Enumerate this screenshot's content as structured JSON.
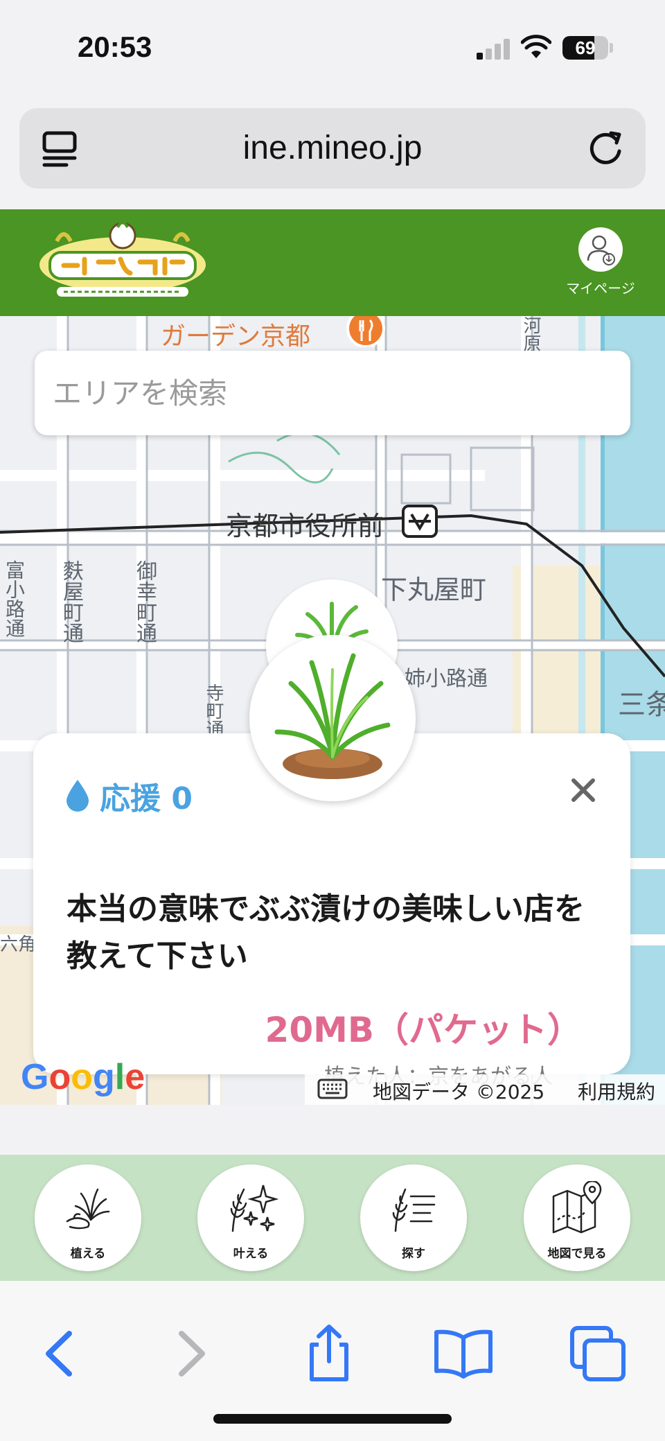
{
  "status_bar": {
    "time": "20:53",
    "battery": "69",
    "battery_level": 0.69
  },
  "browser": {
    "url": "ine.mineo.jp"
  },
  "header": {
    "logo_alt": "ネガイナホ",
    "mypage_label": "マイページ"
  },
  "map": {
    "search_placeholder": "エリアを検索",
    "labels": {
      "restaurant": "ガーデン京都",
      "station": "京都市役所前",
      "town1": "下丸屋町",
      "street_anekoji": "姉小路通",
      "town2": "三条",
      "street_fuyacho": "麩屋町通",
      "street_gokomachi": "御幸町通",
      "street_tominokoji": "富小路通",
      "street_teramachi": "寺町通",
      "rokkaku": "六角通",
      "street_kawaramachi": "河原町通"
    },
    "footer": {
      "map_data": "地図データ ©2025",
      "terms": "利用規約"
    },
    "google": [
      "G",
      "o",
      "o",
      "g",
      "l",
      "e"
    ]
  },
  "wish_card": {
    "cheer_label": "応援 0",
    "text": "本当の意味でぶぶ漬けの美味しい店を教えて下さい",
    "reward": "20MB（パケット）",
    "peek_text": "植えた人：京をあがる人"
  },
  "bottom_nav": [
    {
      "label": "植える",
      "icon": "plant-hand-icon"
    },
    {
      "label": "叶える",
      "icon": "sparkle-rice-icon"
    },
    {
      "label": "探す",
      "icon": "search-list-icon"
    },
    {
      "label": "地図で見る",
      "icon": "map-pin-icon"
    }
  ],
  "colors": {
    "header_green": "#4a9523",
    "nav_green": "#c6e2c4",
    "cheer_blue": "#4aa3e0",
    "reward_pink": "#e06a8f",
    "safari_blue": "#3478f6"
  }
}
